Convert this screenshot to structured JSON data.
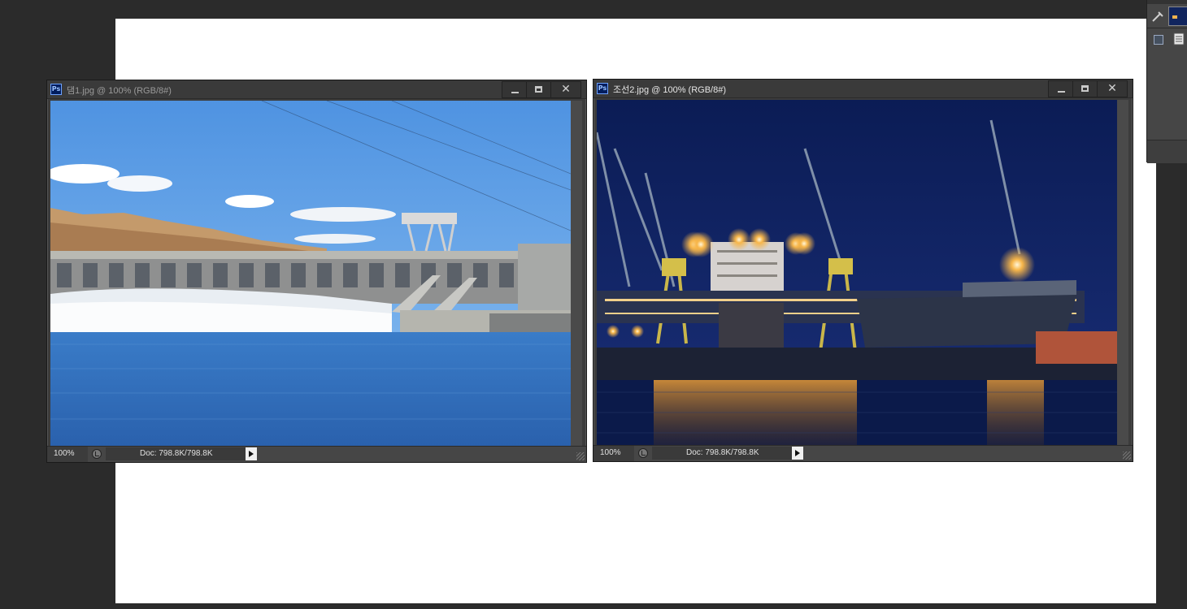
{
  "window1": {
    "app_icon": "Ps",
    "title": "댐1.jpg @ 100% (RGB/8#)",
    "zoom": "100%",
    "doc_info": "Doc: 798.8K/798.8K"
  },
  "window2": {
    "app_icon": "Ps",
    "title": "조선2.jpg @ 100% (RGB/8#)",
    "zoom": "100%",
    "doc_info": "Doc: 798.8K/798.8K"
  },
  "controls": {
    "minimize": "minimize-icon",
    "maximize": "maximize-icon",
    "close": "✕"
  },
  "colors": {
    "app_background": "#2b2b2b",
    "canvas": "#ffffff",
    "sky_day": "#5b9ee6",
    "water_day": "#2f6fbf",
    "sky_night": "#0e1f5c",
    "water_night": "#0b1a4a",
    "harbor_lights": "#f7b64a"
  }
}
